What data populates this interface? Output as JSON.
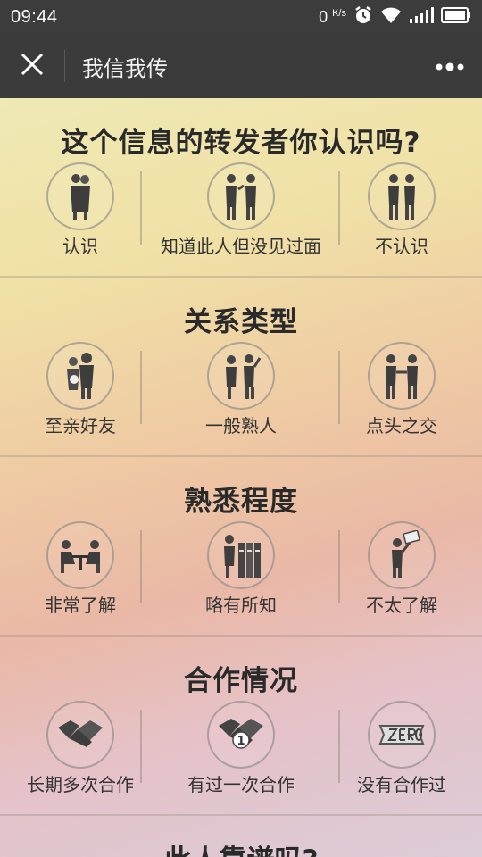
{
  "status_bar": {
    "time": "09:44",
    "net_speed_value": "0",
    "net_speed_unit": "K/s",
    "icons": [
      "alarm-icon",
      "wifi-icon",
      "signal-icon",
      "battery-icon"
    ]
  },
  "nav": {
    "title": "我信我传",
    "close_icon": "close-icon",
    "more_icon": "more-dots-icon"
  },
  "sections": [
    {
      "title": "这个信息的转发者你认识吗?",
      "options": [
        {
          "label": "认识",
          "icon": "embracing-couple-icon"
        },
        {
          "label": "知道此人但没见过面",
          "icon": "passing-strangers-icon"
        },
        {
          "label": "不认识",
          "icon": "two-strangers-icon"
        }
      ]
    },
    {
      "title": "关系类型",
      "options": [
        {
          "label": "至亲好友",
          "icon": "family-icon"
        },
        {
          "label": "一般熟人",
          "icon": "greeting-people-icon"
        },
        {
          "label": "点头之交",
          "icon": "handshake-people-icon"
        }
      ]
    },
    {
      "title": "熟悉程度",
      "options": [
        {
          "label": "非常了解",
          "icon": "meeting-table-icon"
        },
        {
          "label": "略有所知",
          "icon": "file-cabinet-person-icon"
        },
        {
          "label": "不太了解",
          "icon": "sign-holder-icon"
        }
      ]
    },
    {
      "title": "合作情况",
      "options": [
        {
          "label": "长期多次合作",
          "icon": "handshake-icon"
        },
        {
          "label": "有过一次合作",
          "icon": "handshake-number-one-icon"
        },
        {
          "label": "没有合作过",
          "icon": "zero-badge-icon"
        }
      ]
    }
  ],
  "next_section_title": "此人靠谱吗?",
  "colors": {
    "status_bar_bg": "#3c3c3c",
    "nav_bg": "#3b3b3b",
    "title_text": "#2a2a2a"
  }
}
